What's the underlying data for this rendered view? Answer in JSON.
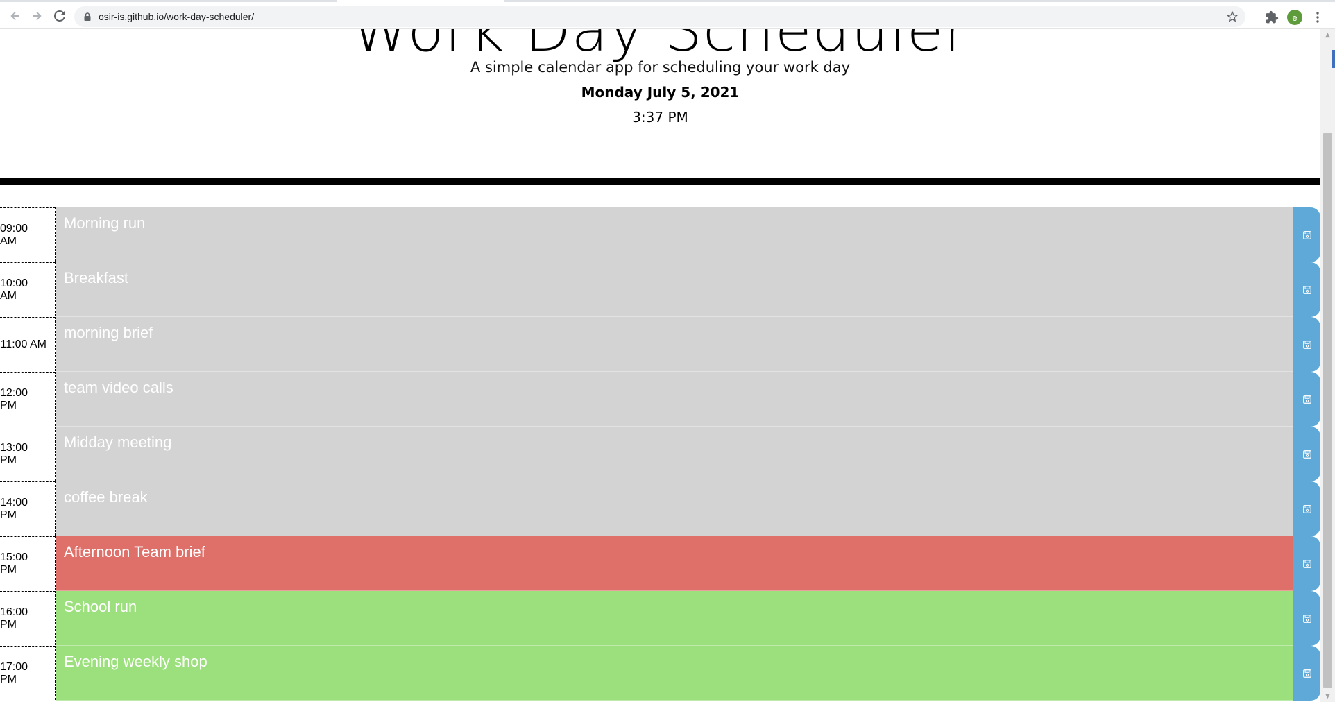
{
  "browser": {
    "url": "osir-is.github.io/work-day-scheduler/",
    "avatar_letter": "e",
    "icons": [
      "back-arrow-icon",
      "forward-arrow-icon",
      "reload-icon",
      "lock-icon",
      "star-icon",
      "extensions-icon",
      "menu-icon"
    ]
  },
  "header": {
    "title": "Work Day Scheduler",
    "lead": "A simple calendar app for scheduling your work day",
    "current_day": "Monday July 5, 2021",
    "current_time": "3:37 PM"
  },
  "timeblocks": [
    {
      "hour": "09:00 AM",
      "task": "Morning run",
      "state": "past"
    },
    {
      "hour": "10:00 AM",
      "task": "Breakfast",
      "state": "past"
    },
    {
      "hour": "11:00 AM",
      "task": "morning brief",
      "state": "past"
    },
    {
      "hour": "12:00 PM",
      "task": "team video calls",
      "state": "past"
    },
    {
      "hour": "13:00 PM",
      "task": "Midday meeting",
      "state": "past"
    },
    {
      "hour": "14:00 PM",
      "task": "coffee break",
      "state": "past"
    },
    {
      "hour": "15:00 PM",
      "task": "Afternoon Team brief",
      "state": "present"
    },
    {
      "hour": "16:00 PM",
      "task": "School run",
      "state": "future"
    },
    {
      "hour": "17:00 PM",
      "task": "Evening weekly shop",
      "state": "future"
    }
  ],
  "colors": {
    "past": "#d3d3d3",
    "present": "#de6f69",
    "future": "#9ce07e",
    "save_button": "#5ea9d8"
  }
}
